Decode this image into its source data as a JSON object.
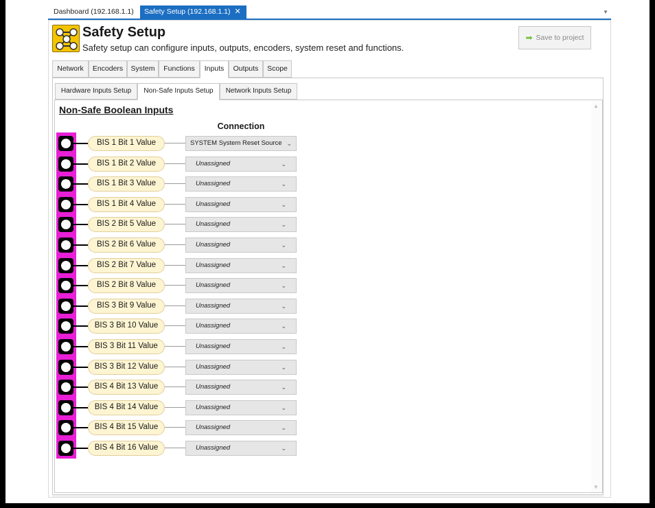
{
  "doc_tabs": [
    {
      "label": "Dashboard (192.168.1.1)",
      "active": false
    },
    {
      "label": "Safety Setup (192.168.1.1)",
      "active": true,
      "close": "✕"
    }
  ],
  "header": {
    "title": "Safety Setup",
    "subtitle": "Safety setup can configure inputs, outputs, encoders, system reset and functions.",
    "save_button": "Save to project",
    "logo_icon": "safety-network-icon",
    "save_icon": "arrow-right-icon"
  },
  "main_tabs": [
    {
      "label": "Network"
    },
    {
      "label": "Encoders"
    },
    {
      "label": "System"
    },
    {
      "label": "Functions"
    },
    {
      "label": "Inputs",
      "active": true
    },
    {
      "label": "Outputs"
    },
    {
      "label": "Scope"
    }
  ],
  "sub_tabs": [
    {
      "label": "Hardware Inputs Setup"
    },
    {
      "label": "Non-Safe Inputs Setup",
      "active": true
    },
    {
      "label": "Network Inputs Setup"
    }
  ],
  "section": {
    "title": "Non-Safe Boolean Inputs",
    "connection_header": "Connection"
  },
  "inputs": [
    {
      "label": "BIS 1 Bit 1 Value",
      "connection": "SYSTEM System Reset Source"
    },
    {
      "label": "BIS 1 Bit 2 Value",
      "connection": "Unassigned"
    },
    {
      "label": "BIS 1 Bit 3 Value",
      "connection": "Unassigned"
    },
    {
      "label": "BIS 1 Bit 4 Value",
      "connection": "Unassigned"
    },
    {
      "label": "BIS 2 Bit 5 Value",
      "connection": "Unassigned"
    },
    {
      "label": "BIS 2 Bit 6 Value",
      "connection": "Unassigned"
    },
    {
      "label": "BIS 2 Bit 7 Value",
      "connection": "Unassigned"
    },
    {
      "label": "BIS 2 Bit 8 Value",
      "connection": "Unassigned"
    },
    {
      "label": "BIS 3 Bit 9 Value",
      "connection": "Unassigned"
    },
    {
      "label": "BIS 3 Bit 10 Value",
      "connection": "Unassigned"
    },
    {
      "label": "BIS 3 Bit 11 Value",
      "connection": "Unassigned"
    },
    {
      "label": "BIS 3 Bit 12 Value",
      "connection": "Unassigned"
    },
    {
      "label": "BIS 4 Bit 13 Value",
      "connection": "Unassigned"
    },
    {
      "label": "BIS 4 Bit 14 Value",
      "connection": "Unassigned"
    },
    {
      "label": "BIS 4 Bit 15 Value",
      "connection": "Unassigned"
    },
    {
      "label": "BIS 4 Bit 16 Value",
      "connection": "Unassigned"
    }
  ],
  "colors": {
    "accent": "#1b6ec2",
    "input_bar": "#e81fd6",
    "logo": "#f5c400",
    "pill_fill": "#fdf4d2"
  }
}
